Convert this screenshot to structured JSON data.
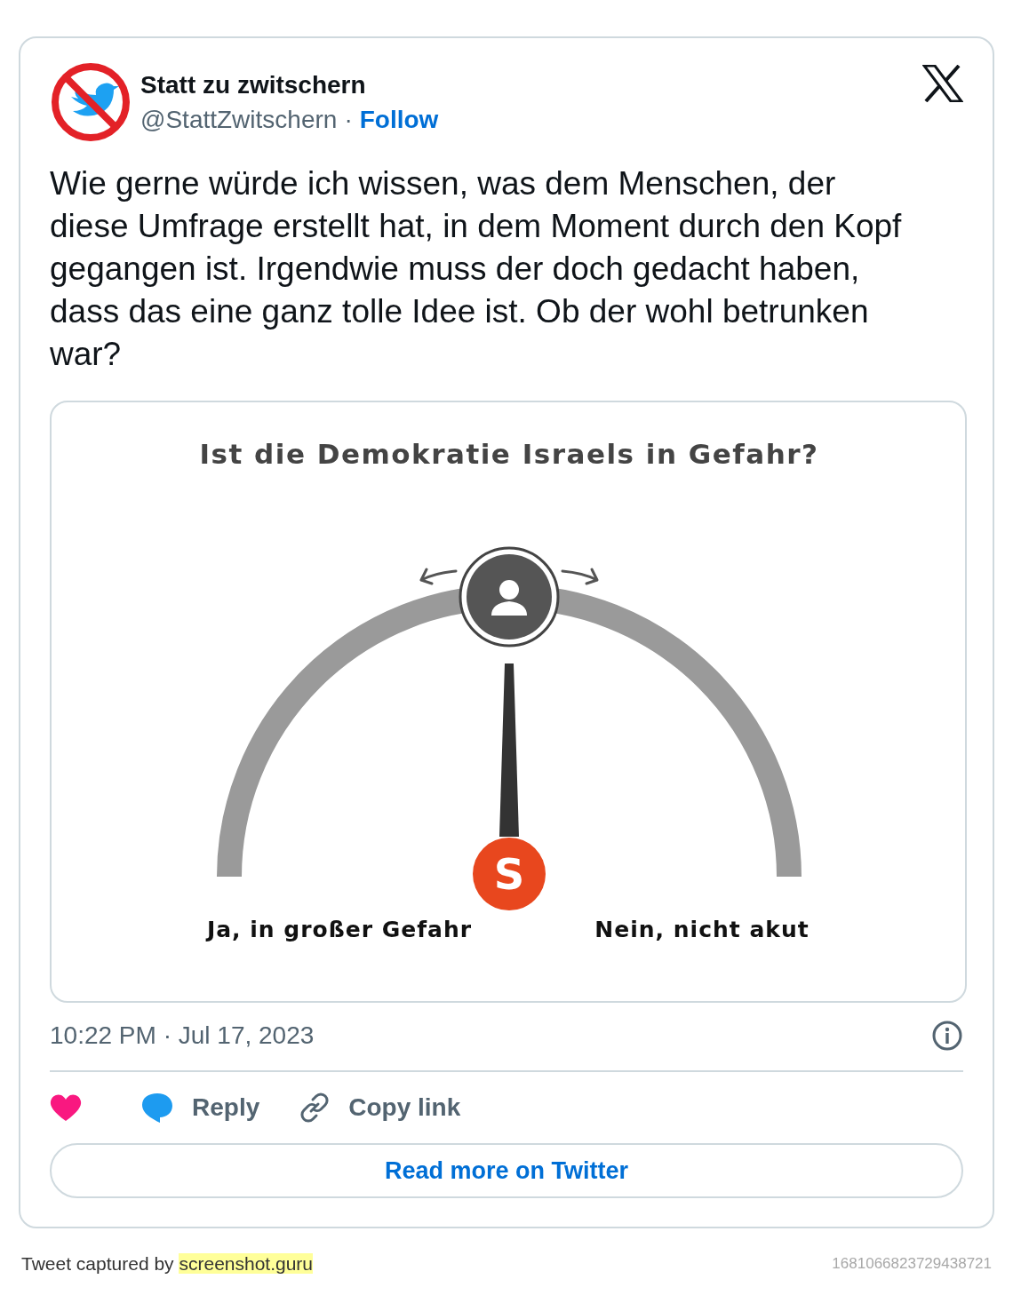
{
  "author": {
    "name": "Statt zu zwitschern",
    "handle": "@StattZwitschern",
    "separator": "·",
    "follow": "Follow"
  },
  "text": "Wie gerne würde ich wissen, was dem Menschen, der diese Umfrage erstellt hat, in dem Moment durch den Kopf gegangen ist. Irgendwie muss der doch gedacht haben, dass das eine ganz tolle Idee ist. Ob der wohl betrunken war?",
  "graphic": {
    "title": "Ist die Demokratie Israels in Gefahr?",
    "logo": "S",
    "left_label": "Ja, in großer Gefahr",
    "right_label": "Nein, nicht akut"
  },
  "timestamp": "10:22 PM · Jul 17, 2023",
  "actions": [
    {
      "kind": "like"
    },
    {
      "kind": "reply",
      "label": "Reply"
    },
    {
      "kind": "copy",
      "label": "Copy link"
    }
  ],
  "read_more": "Read more on Twitter",
  "footer": {
    "caption": "Tweet captured by",
    "link": "screenshot.guru",
    "id": "1681066823729438721"
  }
}
